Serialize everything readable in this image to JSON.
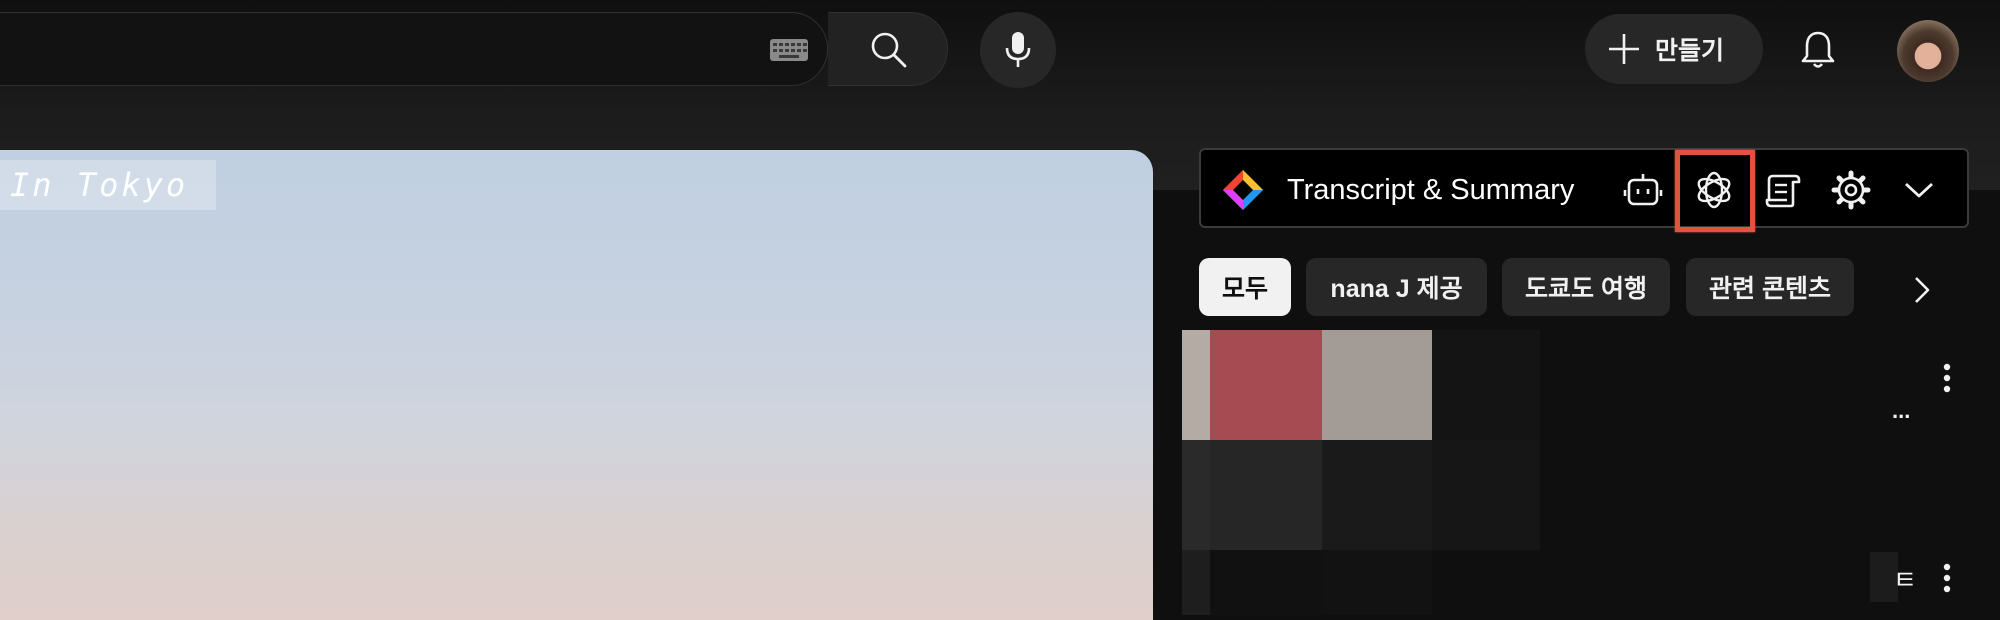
{
  "header": {
    "create_label": "만들기",
    "icons": [
      "keyboard-icon",
      "search-icon",
      "mic-icon",
      "plus-icon",
      "bell-icon"
    ]
  },
  "video": {
    "caption": "In Tokyo"
  },
  "extension": {
    "title": "Transcript & Summary",
    "icons": [
      "bot-icon",
      "openai-icon",
      "scroll-icon",
      "gear-icon",
      "chevron-down-icon"
    ],
    "highlight_color": "#e4523f"
  },
  "chips": [
    {
      "label": "모두",
      "active": true
    },
    {
      "label": "nana J 제공",
      "active": false
    },
    {
      "label": "도쿄도 여행",
      "active": false
    },
    {
      "label": "관련 콘텐츠",
      "active": false
    }
  ],
  "recommendations": {
    "item1_trailing": "...",
    "item2_trailing": "ㅌ"
  },
  "colors": {
    "background": "#0f0f0f",
    "chip": "#272727",
    "chip_active": "#f1f1f1",
    "accent_red": "#e4523f"
  }
}
